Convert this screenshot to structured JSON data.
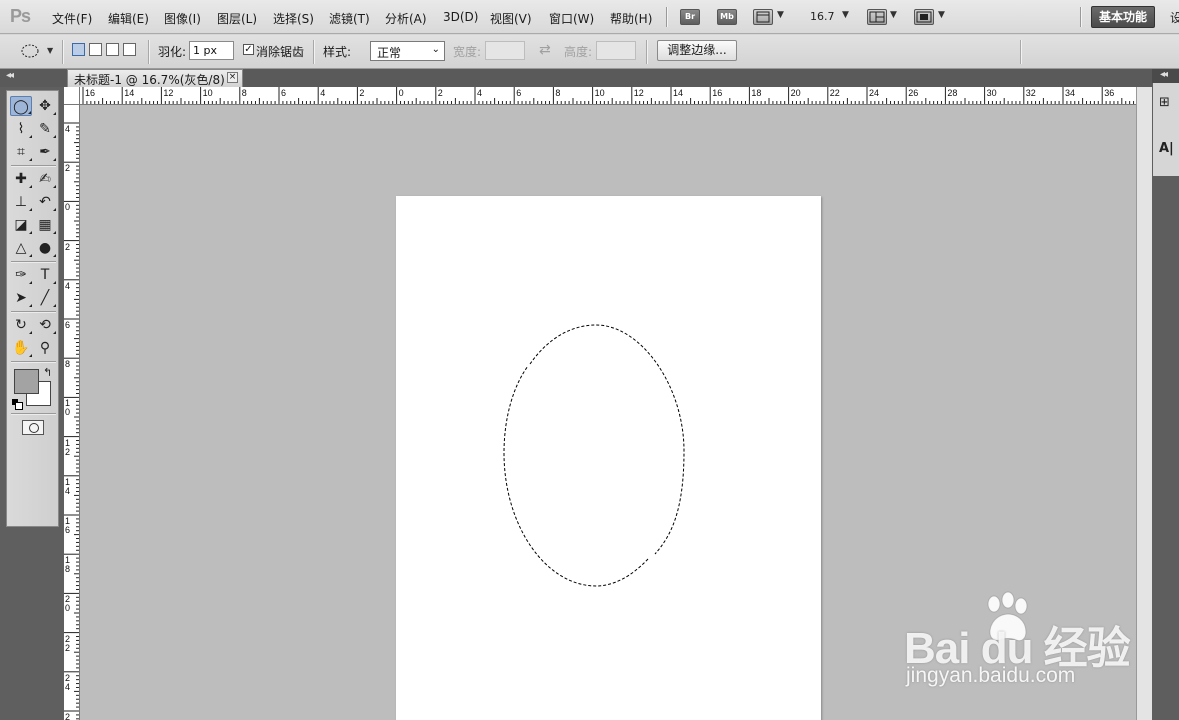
{
  "app": {
    "logo": "Ps",
    "menus": [
      "文件(F)",
      "编辑(E)",
      "图像(I)",
      "图层(L)",
      "选择(S)",
      "滤镜(T)",
      "分析(A)",
      "3D(D)",
      "视图(V)",
      "窗口(W)",
      "帮助(H)"
    ],
    "bridge_label": "Br",
    "minibridge_label": "Mb",
    "zoom_value": "16.7",
    "workspace_label": "基本功能",
    "workspace_more": "设"
  },
  "options": {
    "feather_label": "羽化:",
    "feather_value": "1 px",
    "antialias_label": "消除锯齿",
    "antialias_checked": "✓",
    "style_label": "样式:",
    "style_value": "正常",
    "width_label": "宽度:",
    "height_label": "高度:",
    "refine_edge_label": "调整边缘..."
  },
  "document": {
    "tab_title": "未标题-1 @ 16.7%(灰色/8)",
    "close_glyph": "×",
    "canvas_color": "#ffffff",
    "workspace_color": "#bdbdbd"
  },
  "rulers": {
    "horizontal": [
      "16",
      "14",
      "12",
      "10",
      "8",
      "6",
      "4",
      "2",
      "0",
      "2",
      "4",
      "6",
      "8",
      "10",
      "12",
      "14",
      "16",
      "18",
      "20",
      "22",
      "24",
      "26",
      "28",
      "30",
      "32",
      "34",
      "36"
    ],
    "vertical": [
      "4",
      "2",
      "0",
      "2",
      "4",
      "6",
      "8",
      "10",
      "12",
      "14",
      "16",
      "18",
      "20",
      "22",
      "24",
      "2"
    ]
  },
  "tools": [
    {
      "name": "elliptical-marquee-tool",
      "glyph": "◯"
    },
    {
      "name": "move-tool",
      "glyph": "✥"
    },
    {
      "name": "lasso-tool",
      "glyph": "⌇"
    },
    {
      "name": "quick-selection-tool",
      "glyph": "✎"
    },
    {
      "name": "crop-tool",
      "glyph": "⌗"
    },
    {
      "name": "eyedropper-tool",
      "glyph": "✒"
    },
    {
      "name": "healing-brush-tool",
      "glyph": "✚"
    },
    {
      "name": "brush-tool",
      "glyph": "✍"
    },
    {
      "name": "clone-stamp-tool",
      "glyph": "⊥"
    },
    {
      "name": "history-brush-tool",
      "glyph": "↶"
    },
    {
      "name": "eraser-tool",
      "glyph": "◪"
    },
    {
      "name": "gradient-tool",
      "glyph": "▦"
    },
    {
      "name": "blur-tool",
      "glyph": "△"
    },
    {
      "name": "dodge-tool",
      "glyph": "●"
    },
    {
      "name": "pen-tool",
      "glyph": "✑"
    },
    {
      "name": "type-tool",
      "glyph": "T"
    },
    {
      "name": "path-selection-tool",
      "glyph": "➤"
    },
    {
      "name": "line-tool",
      "glyph": "╱"
    },
    {
      "name": "3d-rotate-tool",
      "glyph": "↻"
    },
    {
      "name": "3d-orbit-tool",
      "glyph": "⟲"
    },
    {
      "name": "hand-tool",
      "glyph": "✋"
    },
    {
      "name": "zoom-tool",
      "glyph": "⚲"
    }
  ],
  "swatches": {
    "foreground": "#a3a3a3",
    "background": "#ffffff",
    "swap_glyph": "↰"
  },
  "dock": {
    "swap_glyph": "⇄",
    "panel1_glyph": "⊞",
    "panel2_glyph": "A|"
  },
  "watermark": {
    "brand": "Bai du 经验",
    "url": "jingyan.baidu.com"
  }
}
